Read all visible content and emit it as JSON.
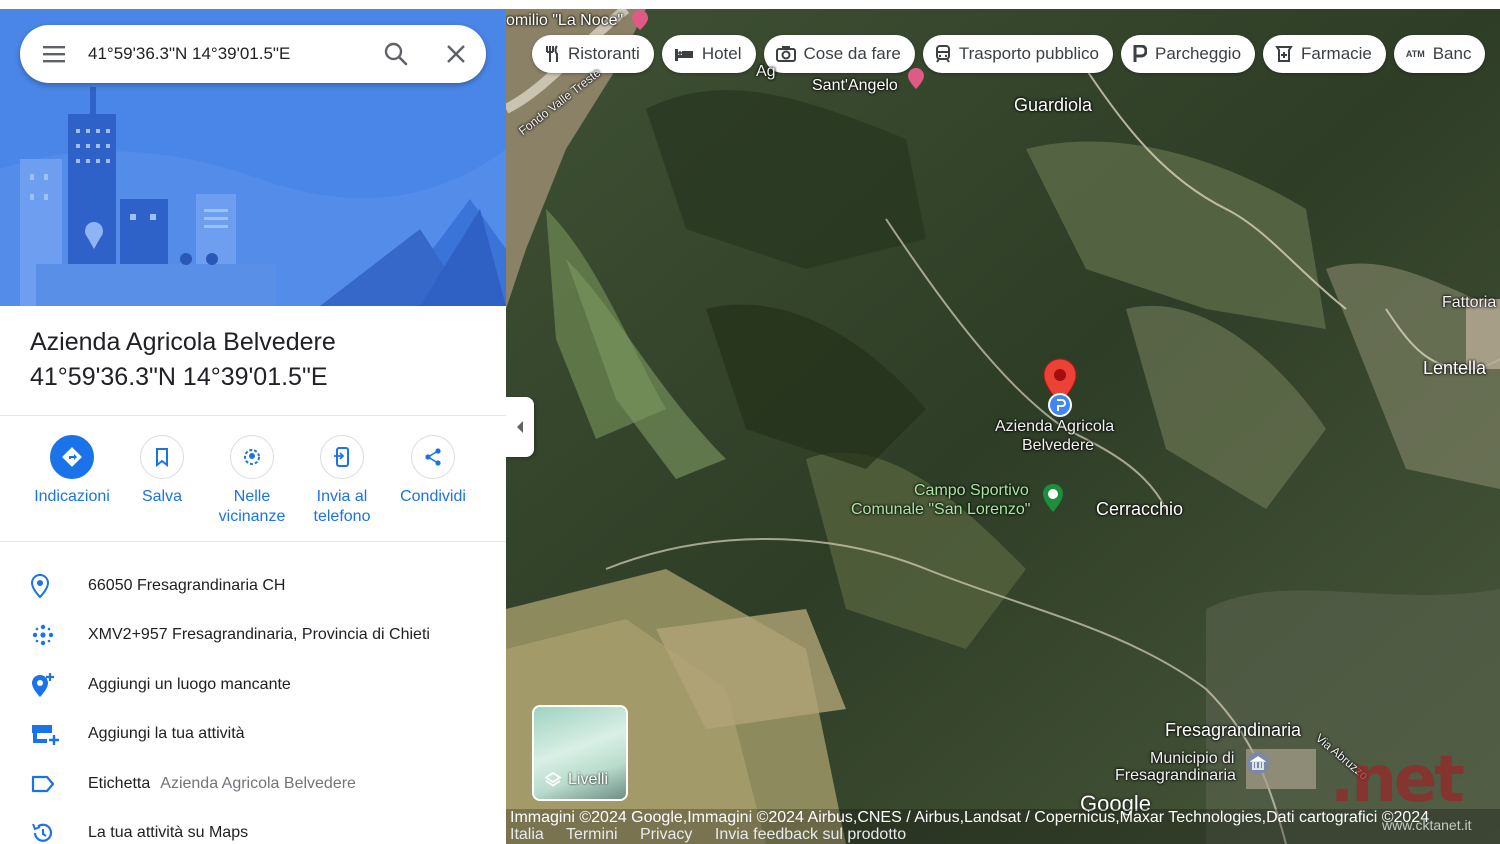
{
  "search": {
    "query": "41°59'36.3\"N 14°39'01.5\"E"
  },
  "place": {
    "title_line1": "Azienda Agricola Belvedere",
    "title_line2": "41°59'36.3\"N 14°39'01.5\"E"
  },
  "actions": [
    {
      "label_1": "Indicazioni",
      "label_2": "",
      "icon": "directions-icon"
    },
    {
      "label_1": "Salva",
      "label_2": "",
      "icon": "bookmark-icon"
    },
    {
      "label_1": "Nelle",
      "label_2": "vicinanze",
      "icon": "nearby-icon"
    },
    {
      "label_1": "Invia al",
      "label_2": "telefono",
      "icon": "send-to-phone-icon"
    },
    {
      "label_1": "Condividi",
      "label_2": "",
      "icon": "share-icon"
    }
  ],
  "info": [
    {
      "text": "66050 Fresagrandinaria CH",
      "sub": "",
      "icon": "location-pin-icon"
    },
    {
      "text": "XMV2+957 Fresagrandinaria, Provincia di Chieti",
      "sub": "",
      "icon": "plus-code-icon"
    },
    {
      "text": "Aggiungi un luogo mancante",
      "sub": "",
      "icon": "add-place-icon"
    },
    {
      "text": "Aggiungi la tua attività",
      "sub": "",
      "icon": "add-business-icon"
    },
    {
      "text": "Etichetta",
      "sub": "Azienda Agricola Belvedere",
      "icon": "label-icon"
    },
    {
      "text": "La tua attività su Maps",
      "sub": "",
      "icon": "history-icon"
    }
  ],
  "chips": [
    {
      "label": "Ristoranti",
      "icon": "restaurant-icon"
    },
    {
      "label": "Hotel",
      "icon": "hotel-icon"
    },
    {
      "label": "Cose da fare",
      "icon": "camera-icon"
    },
    {
      "label": "Trasporto pubblico",
      "icon": "transit-icon"
    },
    {
      "label": "Parcheggio",
      "icon": "parking-icon"
    },
    {
      "label": "Farmacie",
      "icon": "pharmacy-icon"
    },
    {
      "label": "Banc",
      "icon": "atm-icon"
    }
  ],
  "map": {
    "labels": {
      "noce": "omilio \"La Noce\"",
      "santangelo": "Sant'Angelo",
      "guardiola": "Guardiola",
      "fattoria": "Fattoria",
      "lentella": "Lentella",
      "marker1": "Azienda Agricola",
      "marker2": "Belvedere",
      "campo1": "Campo Sportivo",
      "campo2": "Comunale \"San Lorenzo\"",
      "cerracchio": "Cerracchio",
      "fresagrandinaria": "Fresagrandinaria",
      "municipio1": "Municipio di",
      "municipio2": "Fresagrandinaria",
      "road": "Fondo Valle Treste",
      "road2": "Via Abruzzo",
      "ag": "Ag"
    },
    "layers_label": "Livelli",
    "google": "Google",
    "attribution": "Immagini ©2024 Google,Immagini ©2024 Airbus,CNES / Airbus,Landsat / Copernicus,Maxar Technologies,Dati cartografici ©2024",
    "footer_links": [
      "Italia",
      "Termini",
      "Privacy",
      "Invia feedback sul prodotto"
    ],
    "watermark": ".net",
    "watermark_url": "www.cktanet.it"
  },
  "colors": {
    "accent": "#1a73e8",
    "marker": "#ea4335",
    "hero": "#4a86e8"
  }
}
